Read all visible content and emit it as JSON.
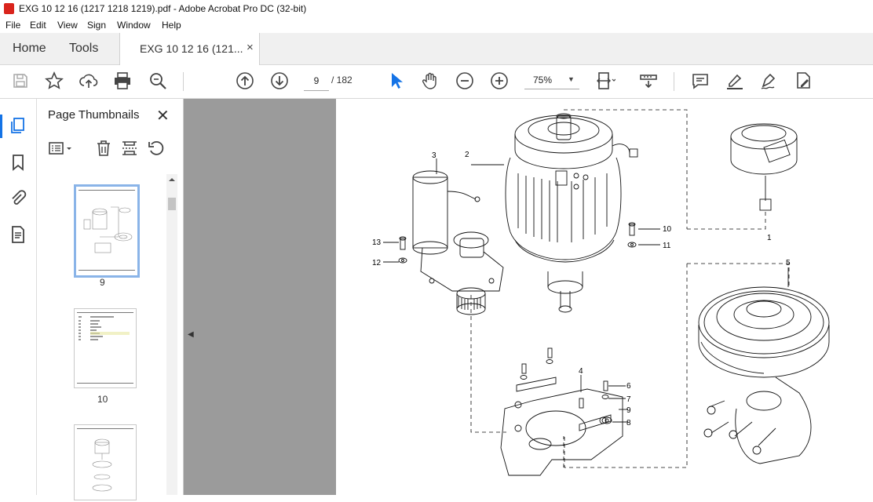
{
  "window": {
    "title": "EXG 10 12 16 (1217 1218 1219).pdf - Adobe Acrobat Pro DC (32-bit)"
  },
  "menu": [
    "File",
    "Edit",
    "View",
    "Sign",
    "Window",
    "Help"
  ],
  "tabs": {
    "home": "Home",
    "tools": "Tools",
    "document": "EXG 10 12 16 (121...",
    "close": "×"
  },
  "toolbar": {
    "icons": [
      "save-icon",
      "bookmark-star-icon",
      "upload-cloud-icon",
      "print-icon",
      "search-zoom-icon",
      "page-up-icon",
      "page-down-icon",
      "select-arrow-icon",
      "hand-icon",
      "zoom-out-icon",
      "zoom-in-icon",
      "fit-page-icon",
      "scroll-mode-icon",
      "comment-icon",
      "highlight-icon",
      "sign-icon",
      "edit-pdf-icon"
    ],
    "current_page": "9",
    "page_separator": "/ 182",
    "zoom": "75%"
  },
  "side_rail": {
    "icons": [
      "page-thumbnails-icon",
      "bookmarks-icon",
      "attachments-icon",
      "page-content-icon"
    ]
  },
  "thumbnails_panel": {
    "title": "Page Thumbnails",
    "close": "✕",
    "tools": [
      "thumbnail-options-icon",
      "delete-page-icon",
      "extract-page-icon",
      "rotate-page-icon"
    ],
    "pages": [
      {
        "label": "9",
        "selected": true
      },
      {
        "label": "10",
        "selected": false
      },
      {
        "label": "",
        "selected": false
      }
    ]
  },
  "diagram": {
    "callouts": [
      "1",
      "2",
      "3",
      "4",
      "5",
      "6",
      "7",
      "8",
      "9",
      "10",
      "11",
      "12",
      "13"
    ]
  },
  "colors": {
    "accent": "#1473e6",
    "pdf_red": "#d9241c",
    "doc_bg": "#9b9b9b"
  }
}
